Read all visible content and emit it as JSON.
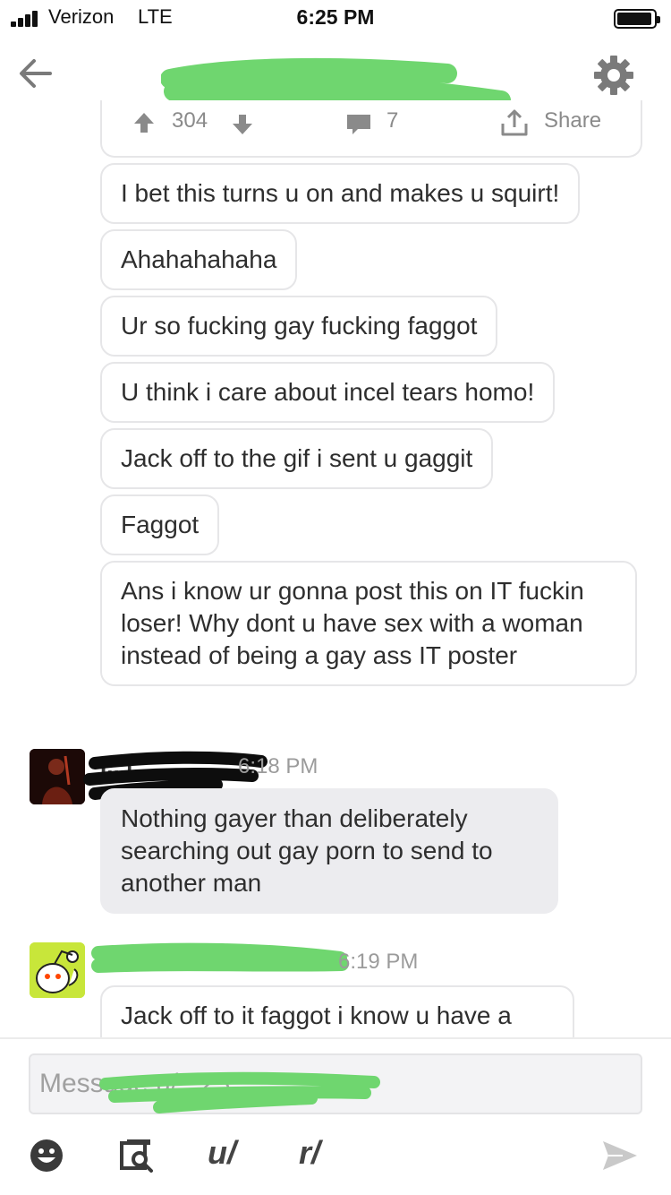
{
  "status_bar": {
    "carrier": "Verizon",
    "network": "LTE",
    "time": "6:25 PM"
  },
  "header": {
    "title": "u/...d123",
    "icons": {
      "back": "arrow-left-icon",
      "settings": "gear-icon"
    }
  },
  "post_card": {
    "votes": "304",
    "comments": "7",
    "share_label": "Share"
  },
  "messages_outgoing": [
    "I bet this turns u on and makes u squirt!",
    "Ahahahahaha",
    "Ur so fucking gay fucking faggot",
    "U think i care about incel tears homo!",
    "Jack off to the gif i sent u gaggit",
    "Faggot",
    "Ans i know ur gonna post this on IT fuckin loser! Why dont u have sex with a woman instead of being a gay ass IT poster"
  ],
  "reply": {
    "sender": "I...t",
    "time": "6:18 PM",
    "text": "Nothing gayer than deliberately searching out gay porn to send to another man"
  },
  "next": {
    "sender": "b...23",
    "time": "6:19 PM",
    "text": "Jack off to it faggot i know u have a"
  },
  "composer": {
    "placeholder": "Message u/...23",
    "tools": [
      "emoji-icon",
      "image-search-icon",
      "u/",
      "r/"
    ],
    "send_icon": "send-icon"
  },
  "colors": {
    "redaction_green": "#6fd66f",
    "redaction_black": "#0d0d0d",
    "reply_bubble": "#ececef",
    "avatar_bg": "#c8e63a"
  }
}
